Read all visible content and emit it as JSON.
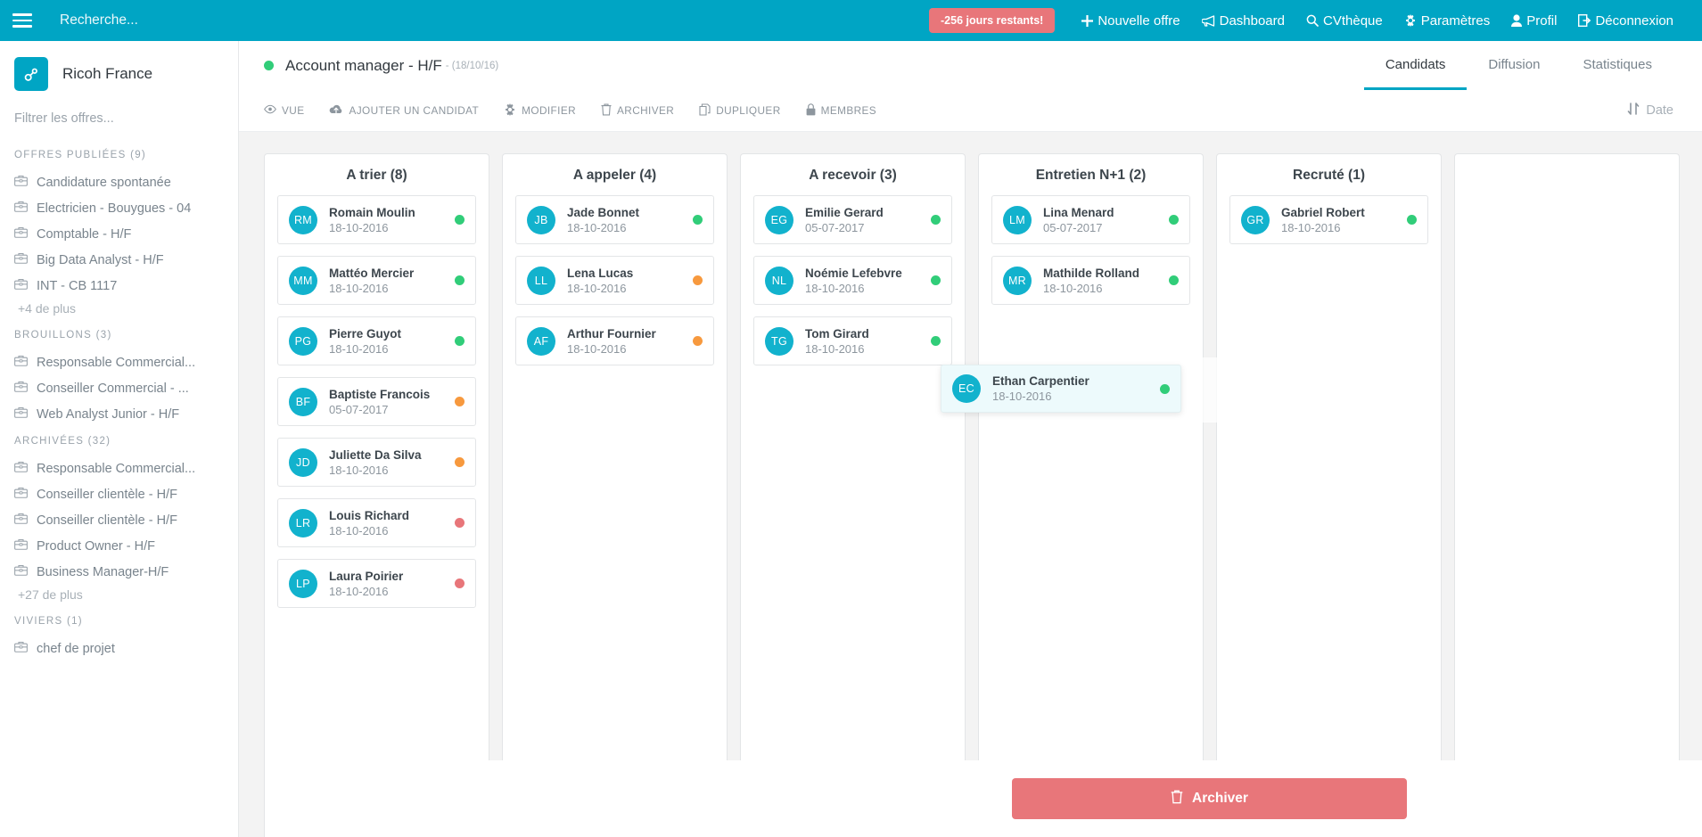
{
  "topbar": {
    "menu_icon": "hamburger-icon",
    "search_placeholder": "Recherche...",
    "search_value": "",
    "days_badge": "-256 jours restants!",
    "nav": [
      {
        "label": "Nouvelle offre",
        "icon": "plus-icon"
      },
      {
        "label": "Dashboard",
        "icon": "megaphone-icon"
      },
      {
        "label": "CVthèque",
        "icon": "search-icon"
      },
      {
        "label": "Paramètres",
        "icon": "gear-icon"
      },
      {
        "label": "Profil",
        "icon": "user-icon"
      },
      {
        "label": "Déconnexion",
        "icon": "logout-icon"
      }
    ],
    "accent_color": "#00a5c4",
    "badge_color": "#e8767a"
  },
  "sidebar": {
    "brand": "Ricoh France",
    "brand_icon": "link-icon",
    "filter_placeholder": "Filtrer les offres...",
    "filter_value": "",
    "sections": [
      {
        "title": "OFFRES PUBLIÉES (9)",
        "items": [
          "Candidature spontanée",
          "Electricien - Bouygues - 04",
          "Comptable - H/F",
          "Big Data Analyst - H/F",
          "INT - CB 1117"
        ],
        "more": "+4 de plus"
      },
      {
        "title": "BROUILLONS (3)",
        "items": [
          "Responsable Commercial...",
          "Conseiller Commercial - ...",
          "Web Analyst Junior - H/F"
        ],
        "more": ""
      },
      {
        "title": "ARCHIVÉES (32)",
        "items": [
          "Responsable Commercial...",
          "Conseiller clientèle - H/F",
          "Conseiller clientèle - H/F",
          "Product Owner - H/F",
          "Business Manager-H/F"
        ],
        "more": "+27 de plus"
      },
      {
        "title": "VIVIERS (1)",
        "items": [
          "chef de projet"
        ],
        "more": ""
      }
    ]
  },
  "page": {
    "status_color": "#31cd79",
    "title": "Account manager - H/F",
    "date": "- (18/10/16)",
    "tabs": [
      {
        "label": "Candidats",
        "active": true
      },
      {
        "label": "Diffusion",
        "active": false
      },
      {
        "label": "Statistiques",
        "active": false
      }
    ],
    "actions": [
      {
        "label": "VUE",
        "icon": "eye-icon"
      },
      {
        "label": "AJOUTER UN CANDIDAT",
        "icon": "cloud-upload-icon"
      },
      {
        "label": "MODIFIER",
        "icon": "gear-icon"
      },
      {
        "label": "ARCHIVER",
        "icon": "trash-icon"
      },
      {
        "label": "DUPLIQUER",
        "icon": "copy-icon"
      },
      {
        "label": "MEMBRES",
        "icon": "lock-icon"
      }
    ],
    "sort": {
      "label": "Date",
      "icon": "sort-icon"
    }
  },
  "board": {
    "columns": [
      {
        "title": "A trier (8)",
        "cards": [
          {
            "initials": "RM",
            "name": "Romain Moulin",
            "date": "18-10-2016",
            "status": "#31cd79"
          },
          {
            "initials": "MM",
            "name": "Mattéo Mercier",
            "date": "18-10-2016",
            "status": "#31cd79"
          },
          {
            "initials": "PG",
            "name": "Pierre Guyot",
            "date": "18-10-2016",
            "status": "#31cd79"
          },
          {
            "initials": "BF",
            "name": "Baptiste Francois",
            "date": "05-07-2017",
            "status": "#f7993e"
          },
          {
            "initials": "JD",
            "name": "Juliette Da Silva",
            "date": "18-10-2016",
            "status": "#f7993e"
          },
          {
            "initials": "LR",
            "name": "Louis Richard",
            "date": "18-10-2016",
            "status": "#e8767a"
          },
          {
            "initials": "LP",
            "name": "Laura Poirier",
            "date": "18-10-2016",
            "status": "#e8767a"
          }
        ]
      },
      {
        "title": "A appeler (4)",
        "cards": [
          {
            "initials": "JB",
            "name": "Jade Bonnet",
            "date": "18-10-2016",
            "status": "#31cd79"
          },
          {
            "initials": "LL",
            "name": "Lena Lucas",
            "date": "18-10-2016",
            "status": "#f7993e"
          },
          {
            "initials": "AF",
            "name": "Arthur Fournier",
            "date": "18-10-2016",
            "status": "#f7993e"
          }
        ]
      },
      {
        "title": "A recevoir (3)",
        "cards": [
          {
            "initials": "EG",
            "name": "Emilie Gerard",
            "date": "05-07-2017",
            "status": "#31cd79"
          },
          {
            "initials": "NL",
            "name": "Noémie Lefebvre",
            "date": "18-10-2016",
            "status": "#31cd79"
          },
          {
            "initials": "TG",
            "name": "Tom Girard",
            "date": "18-10-2016",
            "status": "#31cd79"
          }
        ]
      },
      {
        "title": "Entretien N+1 (2)",
        "cards": [
          {
            "initials": "LM",
            "name": "Lina Menard",
            "date": "05-07-2017",
            "status": "#31cd79"
          },
          {
            "initials": "MR",
            "name": "Mathilde Rolland",
            "date": "18-10-2016",
            "status": "#31cd79"
          }
        ]
      },
      {
        "title": "Recruté (1)",
        "cards": [
          {
            "initials": "GR",
            "name": "Gabriel Robert",
            "date": "18-10-2016",
            "status": "#31cd79"
          }
        ]
      },
      {
        "title": "",
        "cards": []
      }
    ],
    "drag_ghost": {
      "initials": "EC",
      "name": "Ethan Carpentier",
      "date": "18-10-2016",
      "status": "#31cd79"
    }
  },
  "archive": {
    "label": "Archiver",
    "icon": "trash-icon",
    "color": "#e8767a"
  }
}
